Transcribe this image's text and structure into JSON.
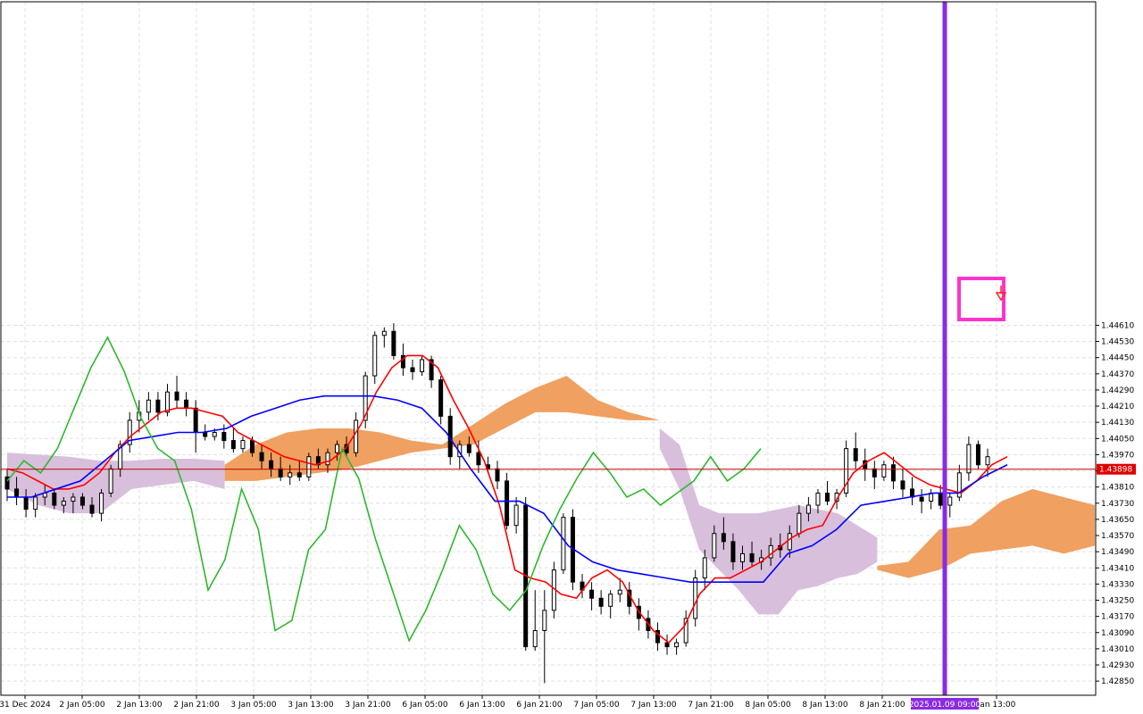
{
  "chart_data": {
    "type": "candlestick",
    "title": "",
    "grid": true,
    "ylim": [
      1.4278,
      1.4621
    ],
    "y_ticks": [
      "1.44610",
      "1.44530",
      "1.44450",
      "1.44370",
      "1.44290",
      "1.44210",
      "1.44130",
      "1.44050",
      "1.43970",
      "1.43890",
      "1.43810",
      "1.43730",
      "1.43650",
      "1.43570",
      "1.43490",
      "1.43410",
      "1.43330",
      "1.43250",
      "1.43170",
      "1.43090",
      "1.43010",
      "1.42930",
      "1.42850"
    ],
    "x_ticks": [
      "31 Dec 2024",
      "2 Jan 05:00",
      "2 Jan 13:00",
      "2 Jan 21:00",
      "3 Jan 05:00",
      "3 Jan 13:00",
      "3 Jan 21:00",
      "6 Jan 05:00",
      "6 Jan 13:00",
      "6 Jan 21:00",
      "7 Jan 05:00",
      "7 Jan 13:00",
      "7 Jan 21:00",
      "8 Jan 05:00",
      "8 Jan 13:00",
      "8 Jan 21:00",
      "2025.01.09 09:00",
      "Jan 13:00"
    ],
    "current_price": "1.43898",
    "current_price_level": 1.43898,
    "vertical_marker_time": "2025.01.09 09:00",
    "candles": [
      [
        1.4386,
        1.439,
        1.4374,
        1.438
      ],
      [
        1.438,
        1.4386,
        1.4372,
        1.4376
      ],
      [
        1.4376,
        1.438,
        1.4366,
        1.437
      ],
      [
        1.437,
        1.4378,
        1.4366,
        1.4376
      ],
      [
        1.4376,
        1.4382,
        1.4372,
        1.4378
      ],
      [
        1.4378,
        1.438,
        1.437,
        1.4372
      ],
      [
        1.4372,
        1.4376,
        1.4368,
        1.4374
      ],
      [
        1.4374,
        1.4378,
        1.4368,
        1.4376
      ],
      [
        1.4376,
        1.4378,
        1.437,
        1.4372
      ],
      [
        1.4372,
        1.4376,
        1.4366,
        1.4368
      ],
      [
        1.4368,
        1.438,
        1.4364,
        1.4378
      ],
      [
        1.4378,
        1.4392,
        1.4376,
        1.439
      ],
      [
        1.439,
        1.4404,
        1.4386,
        1.4402
      ],
      [
        1.4402,
        1.4418,
        1.4398,
        1.4414
      ],
      [
        1.4414,
        1.4424,
        1.4408,
        1.4418
      ],
      [
        1.4418,
        1.4428,
        1.4414,
        1.4424
      ],
      [
        1.4424,
        1.4428,
        1.4414,
        1.4418
      ],
      [
        1.4418,
        1.4432,
        1.4416,
        1.4428
      ],
      [
        1.4428,
        1.4436,
        1.442,
        1.4424
      ],
      [
        1.4424,
        1.4428,
        1.4416,
        1.442
      ],
      [
        1.442,
        1.4424,
        1.4398,
        1.4408
      ],
      [
        1.4408,
        1.4412,
        1.4404,
        1.4406
      ],
      [
        1.4406,
        1.441,
        1.4404,
        1.4408
      ],
      [
        1.4408,
        1.4412,
        1.44,
        1.4404
      ],
      [
        1.4404,
        1.441,
        1.4398,
        1.44
      ],
      [
        1.44,
        1.4406,
        1.4398,
        1.4404
      ],
      [
        1.4404,
        1.4406,
        1.4396,
        1.4398
      ],
      [
        1.4398,
        1.4402,
        1.439,
        1.4394
      ],
      [
        1.4394,
        1.4398,
        1.4386,
        1.439
      ],
      [
        1.439,
        1.4396,
        1.4384,
        1.4386
      ],
      [
        1.4386,
        1.4392,
        1.4382,
        1.4388
      ],
      [
        1.4388,
        1.4394,
        1.4384,
        1.4386
      ],
      [
        1.4386,
        1.4398,
        1.4384,
        1.4396
      ],
      [
        1.4396,
        1.44,
        1.439,
        1.4392
      ],
      [
        1.4392,
        1.44,
        1.4388,
        1.4398
      ],
      [
        1.4398,
        1.4404,
        1.4394,
        1.4402
      ],
      [
        1.4402,
        1.4406,
        1.4396,
        1.4398
      ],
      [
        1.4398,
        1.4418,
        1.4396,
        1.4414
      ],
      [
        1.4414,
        1.4438,
        1.441,
        1.4436
      ],
      [
        1.4436,
        1.4458,
        1.4432,
        1.4456
      ],
      [
        1.4456,
        1.446,
        1.445,
        1.4458
      ],
      [
        1.4458,
        1.4462,
        1.4444,
        1.4446
      ],
      [
        1.4446,
        1.4452,
        1.4436,
        1.444
      ],
      [
        1.444,
        1.4444,
        1.4434,
        1.4438
      ],
      [
        1.4438,
        1.4446,
        1.4436,
        1.4444
      ],
      [
        1.4444,
        1.4446,
        1.443,
        1.4434
      ],
      [
        1.4434,
        1.4436,
        1.4412,
        1.4416
      ],
      [
        1.4416,
        1.442,
        1.4392,
        1.4396
      ],
      [
        1.4396,
        1.4404,
        1.439,
        1.4402
      ],
      [
        1.4402,
        1.4406,
        1.4396,
        1.4398
      ],
      [
        1.4398,
        1.4404,
        1.4388,
        1.4392
      ],
      [
        1.4392,
        1.4396,
        1.4388,
        1.439
      ],
      [
        1.439,
        1.4394,
        1.438,
        1.4384
      ],
      [
        1.4384,
        1.4388,
        1.436,
        1.4362
      ],
      [
        1.4362,
        1.4376,
        1.4358,
        1.4372
      ],
      [
        1.4372,
        1.4376,
        1.43,
        1.4302
      ],
      [
        1.4302,
        1.433,
        1.43,
        1.431
      ],
      [
        1.431,
        1.433,
        1.4284,
        1.432
      ],
      [
        1.432,
        1.4344,
        1.4316,
        1.434
      ],
      [
        1.434,
        1.4368,
        1.4338,
        1.4366
      ],
      [
        1.4366,
        1.437,
        1.433,
        1.4334
      ],
      [
        1.4334,
        1.4338,
        1.4326,
        1.433
      ],
      [
        1.433,
        1.4334,
        1.432,
        1.4326
      ],
      [
        1.4326,
        1.433,
        1.4318,
        1.4322
      ],
      [
        1.4322,
        1.433,
        1.4316,
        1.4328
      ],
      [
        1.4328,
        1.4336,
        1.4324,
        1.433
      ],
      [
        1.433,
        1.4334,
        1.4318,
        1.4322
      ],
      [
        1.4322,
        1.4326,
        1.431,
        1.4316
      ],
      [
        1.4316,
        1.432,
        1.4306,
        1.431
      ],
      [
        1.431,
        1.4314,
        1.43,
        1.4304
      ],
      [
        1.4304,
        1.4308,
        1.4298,
        1.4302
      ],
      [
        1.4302,
        1.4306,
        1.4298,
        1.4304
      ],
      [
        1.4304,
        1.432,
        1.4302,
        1.4316
      ],
      [
        1.4316,
        1.434,
        1.4312,
        1.4336
      ],
      [
        1.4336,
        1.435,
        1.433,
        1.4346
      ],
      [
        1.4346,
        1.4362,
        1.4344,
        1.4358
      ],
      [
        1.4358,
        1.4366,
        1.435,
        1.4354
      ],
      [
        1.4354,
        1.4358,
        1.434,
        1.4344
      ],
      [
        1.4344,
        1.4352,
        1.434,
        1.4348
      ],
      [
        1.4348,
        1.4354,
        1.4342,
        1.4344
      ],
      [
        1.4344,
        1.435,
        1.434,
        1.4346
      ],
      [
        1.4346,
        1.4356,
        1.4342,
        1.4352
      ],
      [
        1.4352,
        1.4358,
        1.4346,
        1.435
      ],
      [
        1.435,
        1.4362,
        1.4346,
        1.4358
      ],
      [
        1.4358,
        1.4372,
        1.4356,
        1.4368
      ],
      [
        1.4368,
        1.4376,
        1.4364,
        1.4372
      ],
      [
        1.4372,
        1.438,
        1.4368,
        1.4378
      ],
      [
        1.4378,
        1.4384,
        1.4372,
        1.4374
      ],
      [
        1.4374,
        1.438,
        1.437,
        1.4378
      ],
      [
        1.4378,
        1.4404,
        1.4376,
        1.44
      ],
      [
        1.44,
        1.4408,
        1.439,
        1.4394
      ],
      [
        1.4394,
        1.44,
        1.4384,
        1.439
      ],
      [
        1.439,
        1.4394,
        1.438,
        1.4386
      ],
      [
        1.4386,
        1.4394,
        1.4384,
        1.4392
      ],
      [
        1.4392,
        1.4396,
        1.438,
        1.4384
      ],
      [
        1.4384,
        1.439,
        1.4376,
        1.438
      ],
      [
        1.438,
        1.4386,
        1.4372,
        1.4376
      ],
      [
        1.4376,
        1.438,
        1.4368,
        1.4374
      ],
      [
        1.4374,
        1.438,
        1.437,
        1.4378
      ],
      [
        1.4378,
        1.4382,
        1.437,
        1.4372
      ],
      [
        1.4372,
        1.4378,
        1.4366,
        1.4376
      ],
      [
        1.4376,
        1.4392,
        1.4374,
        1.4388
      ],
      [
        1.4388,
        1.4406,
        1.4384,
        1.4402
      ],
      [
        1.4402,
        1.4404,
        1.439,
        1.4392
      ],
      [
        1.4392,
        1.44,
        1.4386,
        1.4396
      ]
    ],
    "series": [
      {
        "color": "#ff0000",
        "values": [
          1.439,
          1.4388,
          1.4384,
          1.438,
          1.438,
          1.4382,
          1.4388,
          1.4398,
          1.4406,
          1.4412,
          1.4418,
          1.442,
          1.442,
          1.4418,
          1.4416,
          1.4408,
          1.4404,
          1.44,
          1.4396,
          1.4394,
          1.4392,
          1.4394,
          1.44,
          1.4412,
          1.4428,
          1.444,
          1.4446,
          1.4446,
          1.444,
          1.4424,
          1.441,
          1.4394,
          1.4372,
          1.434,
          1.4336,
          1.4334,
          1.4328,
          1.4326,
          1.4336,
          1.434,
          1.4334,
          1.432,
          1.431,
          1.4304,
          1.4312,
          1.4328,
          1.4336,
          1.4336,
          1.434,
          1.4344,
          1.435,
          1.4356,
          1.436,
          1.4362,
          1.4376,
          1.4388,
          1.4394,
          1.4398,
          1.4392,
          1.4386,
          1.4382,
          1.438,
          1.4378,
          1.4384,
          1.4392,
          1.4396
        ]
      },
      {
        "color": "#0000ff",
        "values": [
          1.4376,
          1.4376,
          1.438,
          1.4384,
          1.4394,
          1.4404,
          1.4406,
          1.4408,
          1.4408,
          1.441,
          1.4416,
          1.442,
          1.4424,
          1.4426,
          1.4426,
          1.4426,
          1.4424,
          1.442,
          1.4408,
          1.439,
          1.4374,
          1.4374,
          1.4368,
          1.4352,
          1.4344,
          1.434,
          1.4338,
          1.4336,
          1.4334,
          1.4334,
          1.4334,
          1.4334,
          1.4348,
          1.4352,
          1.436,
          1.4372,
          1.4374,
          1.4376,
          1.4378,
          1.4378,
          1.4386,
          1.4392
        ]
      },
      {
        "color": "#2eb82e",
        "values": [
          1.4384,
          1.4394,
          1.4388,
          1.44,
          1.442,
          1.444,
          1.4455,
          1.4438,
          1.4415,
          1.44,
          1.4394,
          1.437,
          1.433,
          1.4345,
          1.438,
          1.436,
          1.431,
          1.4315,
          1.435,
          1.436,
          1.44,
          1.4385,
          1.4355,
          1.433,
          1.4305,
          1.432,
          1.434,
          1.4362,
          1.435,
          1.4328,
          1.432,
          1.433,
          1.4352,
          1.437,
          1.4385,
          1.4398,
          1.4388,
          1.4376,
          1.438,
          1.4372,
          1.4378,
          1.4384,
          1.4396,
          1.4384,
          1.439,
          1.44
        ]
      }
    ],
    "cloud": {
      "bullish_color": "#f0a060",
      "bearish_color": "#d8bfdc",
      "spans": [
        {
          "kind": "bearish",
          "top": [
            1.4398,
            1.4397,
            1.4396,
            1.4394,
            1.4394,
            1.4395,
            1.4395,
            1.4394
          ],
          "bottom": [
            1.438,
            1.4372,
            1.4368,
            1.4368,
            1.438,
            1.4382,
            1.4384,
            1.438
          ]
        },
        {
          "kind": "bullish",
          "top": [
            1.4392,
            1.4402,
            1.4408,
            1.441,
            1.441,
            1.4408,
            1.4404,
            1.4402
          ],
          "bottom": [
            1.4384,
            1.4384,
            1.4386,
            1.4388,
            1.439,
            1.4394,
            1.4398,
            1.44
          ]
        },
        {
          "kind": "bullish",
          "top": [
            1.4402,
            1.4412,
            1.4422,
            1.443,
            1.4436,
            1.4424,
            1.4418,
            1.4414
          ],
          "bottom": [
            1.44,
            1.4402,
            1.441,
            1.4418,
            1.4418,
            1.4416,
            1.4414,
            1.4414
          ]
        },
        {
          "kind": "bearish",
          "top": [
            1.441,
            1.4402,
            1.4372,
            1.4368,
            1.4368,
            1.4368,
            1.437,
            1.4372,
            1.437,
            1.4368,
            1.4362,
            1.4356
          ],
          "bottom": [
            1.44,
            1.438,
            1.435,
            1.434,
            1.433,
            1.4318,
            1.4318,
            1.433,
            1.4332,
            1.4336,
            1.4338,
            1.4344
          ]
        },
        {
          "kind": "bullish",
          "top": [
            1.4342,
            1.4344,
            1.436,
            1.4362,
            1.4374,
            1.438,
            1.4376,
            1.4372
          ],
          "bottom": [
            1.434,
            1.4336,
            1.434,
            1.4348,
            1.435,
            1.4352,
            1.4348,
            1.4352
          ]
        }
      ]
    }
  }
}
